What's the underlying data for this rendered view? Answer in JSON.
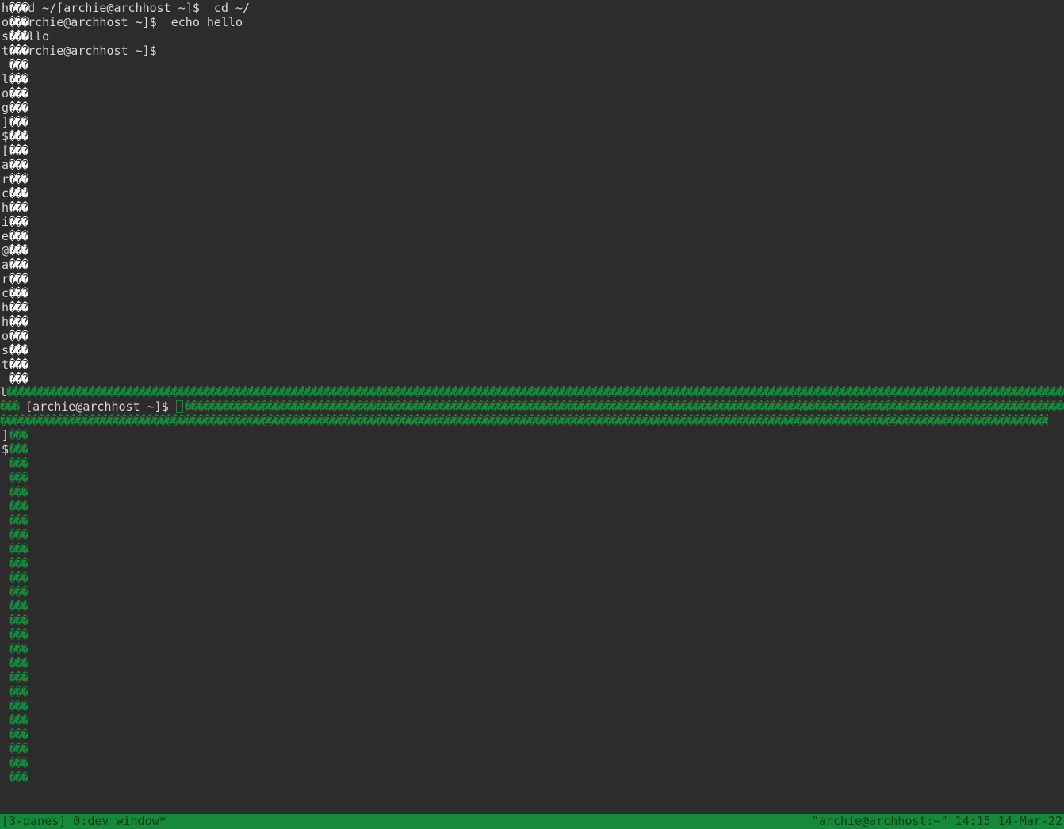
{
  "glyph": "���",
  "top_pane": {
    "lines": [
      {
        "lead": "h",
        "text": "d ~/[archie@archhost ~]$  cd ~/"
      },
      {
        "lead": "o",
        "text": "rchie@archhost ~]$  echo hello"
      },
      {
        "lead": "s",
        "text": "llo"
      },
      {
        "lead": "t",
        "text": "rchie@archhost ~]$"
      }
    ],
    "column_leads": [
      " ",
      "l",
      "o",
      "g",
      "]",
      "$",
      "[",
      "a",
      "r",
      "c",
      "h",
      "i",
      "e",
      "@",
      "a",
      "r",
      "c",
      "h",
      "h",
      "o",
      "s",
      "t",
      " "
    ]
  },
  "separator": {
    "lead": "l",
    "prompt": "[archie@archhost ~]$ "
  },
  "bottom_pane": {
    "leads": [
      "]",
      "$",
      " ",
      " ",
      " ",
      " ",
      " ",
      " ",
      " ",
      " ",
      " ",
      " ",
      " ",
      " ",
      " ",
      " ",
      " ",
      " ",
      " ",
      " ",
      " ",
      " ",
      " ",
      " ",
      " "
    ]
  },
  "statusbar": {
    "left": "[3-panes] 0:dev window*",
    "right": "\"archie@archhost:~\" 14:15 14-Mar-22"
  },
  "colors": {
    "background": "#2d2b2c",
    "text": "#d8d8d8",
    "accent_green": "#16893a",
    "status_text": "#0a3d1a"
  }
}
